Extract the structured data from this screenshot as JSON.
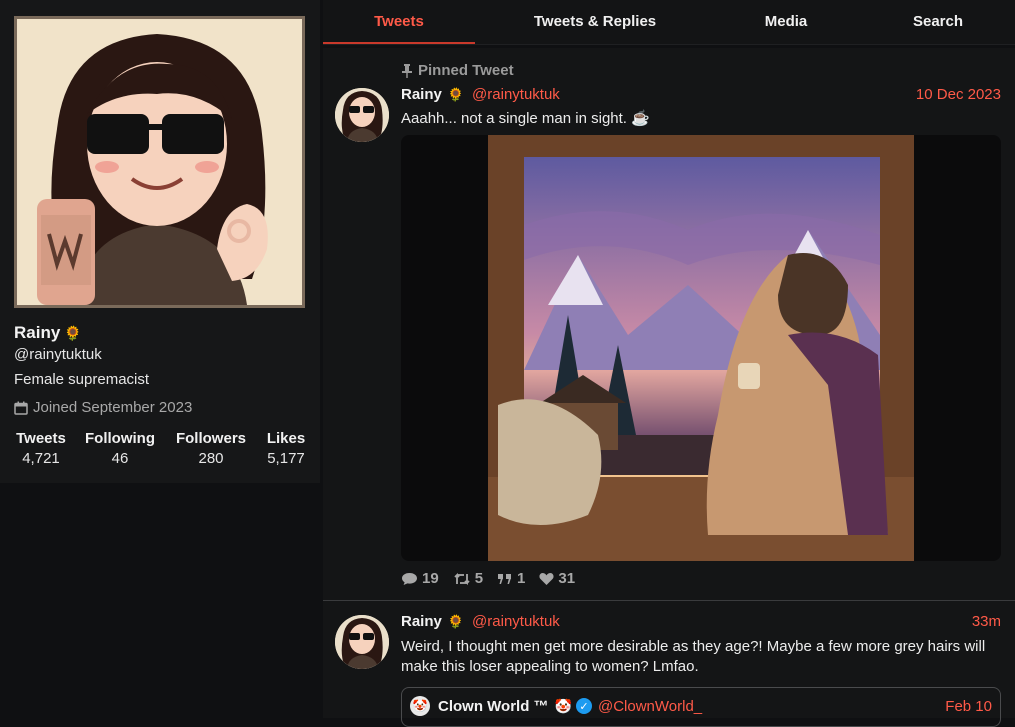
{
  "profile": {
    "name": "Rainy",
    "name_emoji": "🌻",
    "handle": "@rainytuktuk",
    "bio": "Female supremacist",
    "joined": "Joined September 2023",
    "stats": [
      {
        "label": "Tweets",
        "value": "4,721"
      },
      {
        "label": "Following",
        "value": "46"
      },
      {
        "label": "Followers",
        "value": "280"
      },
      {
        "label": "Likes",
        "value": "5,177"
      }
    ]
  },
  "tabs": [
    {
      "label": "Tweets",
      "active": true
    },
    {
      "label": "Tweets & Replies",
      "active": false
    },
    {
      "label": "Media",
      "active": false
    },
    {
      "label": "Search",
      "active": false
    }
  ],
  "tweets": [
    {
      "pinned_label": "Pinned Tweet",
      "name": "Rainy",
      "name_emoji": "🌻",
      "handle": "@rainytuktuk",
      "date": "10 Dec 2023",
      "text": "Aaahh... not a single man in sight. ☕",
      "stats": {
        "replies": "19",
        "retweets": "5",
        "quotes": "1",
        "likes": "31"
      }
    },
    {
      "name": "Rainy",
      "name_emoji": "🌻",
      "handle": "@rainytuktuk",
      "date": "33m",
      "text": "Weird, I thought men get more desirable as they age?! Maybe a few more grey hairs will make this loser appealing to women? Lmfao.",
      "quote": {
        "name": "Clown World ™",
        "emoji": "🤡",
        "handle": "@ClownWorld_",
        "date": "Feb 10"
      }
    }
  ],
  "colors": {
    "accent": "#ff5a48",
    "background": "#0f1012",
    "panel": "#161718"
  }
}
